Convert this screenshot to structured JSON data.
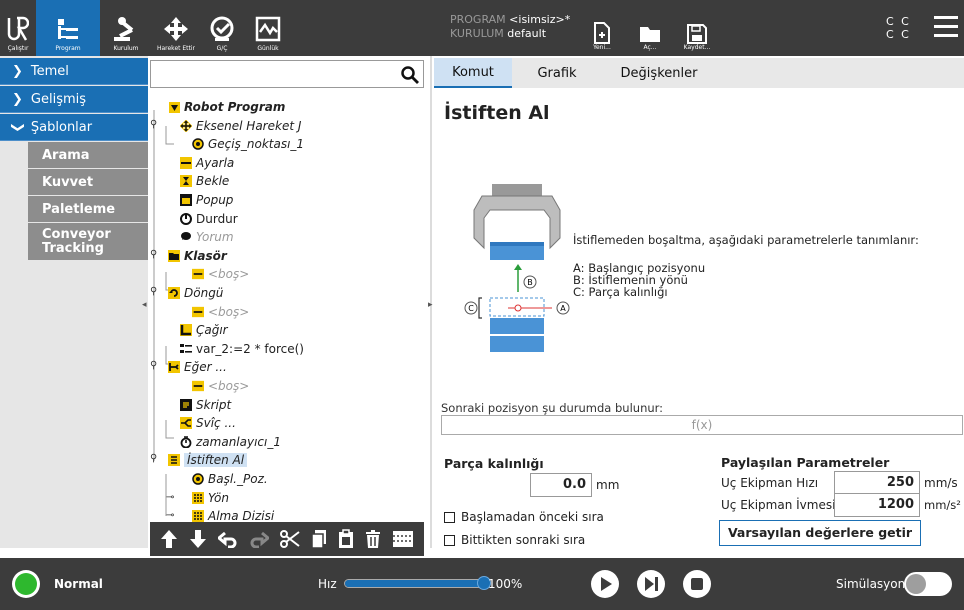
{
  "header": {
    "nav": [
      {
        "label": "Çalıştır",
        "icon": "ur-logo-icon"
      },
      {
        "label": "Program",
        "icon": "program-icon"
      },
      {
        "label": "Kurulum",
        "icon": "robot-arm-icon"
      },
      {
        "label": "Hareket Ettir",
        "icon": "move-arrows-icon"
      },
      {
        "label": "G/Ç",
        "icon": "io-icon"
      },
      {
        "label": "Günlük",
        "icon": "log-icon"
      }
    ],
    "program_key": "PROGRAM",
    "program_value": "<isimsiz>*",
    "installation_key": "KURULUM",
    "installation_value": "default",
    "file_buttons": [
      {
        "label": "Yeni...",
        "icon": "new-file-icon"
      },
      {
        "label": "Aç...",
        "icon": "open-folder-icon"
      },
      {
        "label": "Kaydet...",
        "icon": "save-icon"
      }
    ],
    "status_line1": "C C",
    "status_line2": "C C",
    "menu_icon": "hamburger-menu-icon"
  },
  "left_menu": {
    "sections": [
      {
        "label": "Temel",
        "expanded": false
      },
      {
        "label": "Gelişmiş",
        "expanded": false
      },
      {
        "label": "Şablonlar",
        "expanded": true
      }
    ],
    "templates": [
      "Arama",
      "Kuvvet",
      "Paletleme",
      "Conveyor Tracking"
    ]
  },
  "tree": {
    "search_value": "",
    "items": [
      {
        "label": "Robot Program",
        "icon": "program-triangle-icon",
        "bold": true
      },
      {
        "label": "Eksenel Hareket J",
        "icon": "movej-icon"
      },
      {
        "label": "Geçiş_noktası_1",
        "icon": "waypoint-icon"
      },
      {
        "label": "Ayarla",
        "icon": "set-icon"
      },
      {
        "label": "Bekle",
        "icon": "hourglass-icon"
      },
      {
        "label": "Popup",
        "icon": "popup-icon"
      },
      {
        "label": "Durdur",
        "icon": "halt-icon"
      },
      {
        "label": "Yorum",
        "icon": "comment-icon"
      },
      {
        "label": "Klasör",
        "icon": "folder-icon",
        "bold": true
      },
      {
        "label": "<boş>",
        "icon": "empty-icon"
      },
      {
        "label": "Döngü",
        "icon": "loop-icon"
      },
      {
        "label": "<boş>",
        "icon": "empty-icon"
      },
      {
        "label": "Çağır",
        "icon": "call-icon"
      },
      {
        "label": "var_2:=2 * force()",
        "icon": "assignment-icon"
      },
      {
        "label": "Eğer ...",
        "icon": "if-icon"
      },
      {
        "label": "<boş>",
        "icon": "empty-icon"
      },
      {
        "label": "Skript",
        "icon": "script-icon"
      },
      {
        "label": "Svîç ...",
        "icon": "switch-icon"
      },
      {
        "label": "zamanlayıcı_1",
        "icon": "timer-icon"
      },
      {
        "label": "İstiften Al",
        "icon": "destack-icon",
        "selected": true
      },
      {
        "label": "Başl._Poz.",
        "icon": "waypoint-icon"
      },
      {
        "label": "Yön",
        "icon": "grid-icon"
      },
      {
        "label": "Alma Dizisi",
        "icon": "grid-icon"
      }
    ],
    "toolbar_icons": [
      "move-up-icon",
      "move-down-icon",
      "undo-icon",
      "redo-icon",
      "cut-icon",
      "copy-icon",
      "paste-icon",
      "delete-icon",
      "suppress-icon"
    ]
  },
  "tabs": [
    "Komut",
    "Grafik",
    "Değişkenler"
  ],
  "command": {
    "title": "İstiften Al",
    "description": "İstiflemeden boşaltma, aşağıdaki parametrelerle tanımlanır:",
    "legend": [
      "A: Başlangıç pozisyonu",
      "B: İstiflemenin yönü",
      "C: Parça kalınlığı"
    ],
    "diagram_labels": {
      "a": "A",
      "b": "B",
      "c": "C"
    },
    "next_position_label": "Sonraki pozisyon şu durumda bulunur:",
    "expression_placeholder": "f(x)",
    "thickness_label": "Parça kalınlığı",
    "thickness_value": "0.0",
    "thickness_unit": "mm",
    "checkbox_before": "Başlamadan önceki sıra",
    "checkbox_after": "Bittikten sonraki sıra",
    "shared_title": "Paylaşılan Parametreler",
    "tool_speed_label": "Uç Ekipman Hızı",
    "tool_speed_value": "250",
    "tool_speed_unit": "mm/s",
    "tool_accel_label": "Uç Ekipman İvmesi",
    "tool_accel_value": "1200",
    "tool_accel_unit": "mm/s²",
    "reset_button": "Varsayılan değerlere getir"
  },
  "footer": {
    "status": "Normal",
    "speed_label": "Hız",
    "speed_percent": "100%",
    "speed_fraction": 1.0,
    "simulation_label": "Simülasyon",
    "colors": {
      "status_green": "#2eb82e",
      "accent": "#1a6fb4"
    }
  }
}
